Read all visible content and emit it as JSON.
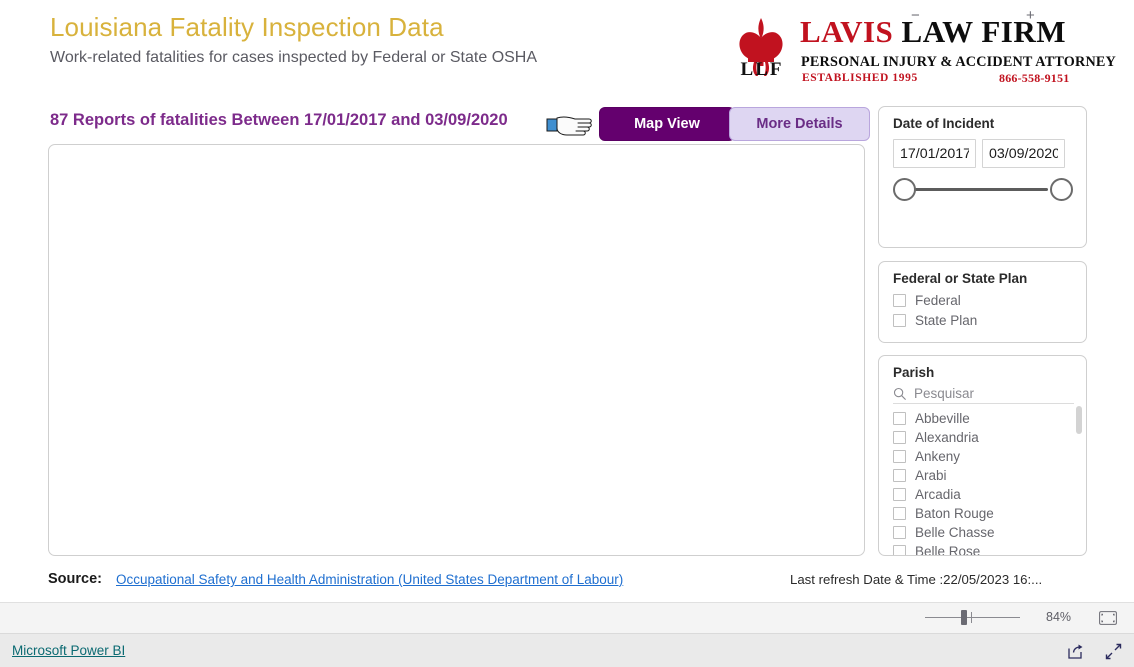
{
  "header": {
    "title": "Louisiana Fatality Inspection Data",
    "subtitle": "Work-related fatalities for cases inspected by Federal or State OSHA",
    "title_color": "#d8b23c"
  },
  "logo": {
    "name_red": "LAVIS",
    "name_black": "LAW FIRM",
    "tagline": "PERSONAL INJURY & ACCIDENT ATTORNEY",
    "established": "ESTABLISHED 1995",
    "phone": "866-558-9151",
    "monogram": "LLF",
    "accent_color": "#c1121f"
  },
  "summary": {
    "report_line": "87 Reports of fatalities Between 17/01/2017 and 03/09/2020",
    "count": 87,
    "date_from": "17/01/2017",
    "date_to": "03/09/2020",
    "color": "#7d2b8b"
  },
  "buttons": {
    "map_view": "Map View",
    "more_details": "More Details",
    "map_view_bg": "#64006e",
    "more_details_bg": "#ded6f2"
  },
  "filters": {
    "date": {
      "title": "Date of Incident",
      "from_value": "17/01/2017",
      "to_value": "03/09/2020"
    },
    "plan": {
      "title": "Federal or State Plan",
      "options": [
        {
          "label": "Federal",
          "checked": false
        },
        {
          "label": "State Plan",
          "checked": false
        }
      ]
    },
    "parish": {
      "title": "Parish",
      "search_placeholder": "Pesquisar",
      "search_value": "",
      "options": [
        {
          "label": "Abbeville",
          "checked": false
        },
        {
          "label": "Alexandria",
          "checked": false
        },
        {
          "label": "Ankeny",
          "checked": false
        },
        {
          "label": "Arabi",
          "checked": false
        },
        {
          "label": "Arcadia",
          "checked": false
        },
        {
          "label": "Baton Rouge",
          "checked": false
        },
        {
          "label": "Belle Chasse",
          "checked": false
        },
        {
          "label": "Belle Rose",
          "checked": false
        }
      ]
    }
  },
  "footer": {
    "source_label": "Source:",
    "source_link": "Occupational Safety and Health Administration (United States Department of Labour)",
    "refresh_text": "Last refresh Date & Time :22/05/2023 16:..."
  },
  "toolbar": {
    "zoom_minus": "−",
    "zoom_plus": "+",
    "zoom_percent": "84%"
  },
  "bottom": {
    "powerbi_label": "Microsoft Power BI"
  }
}
